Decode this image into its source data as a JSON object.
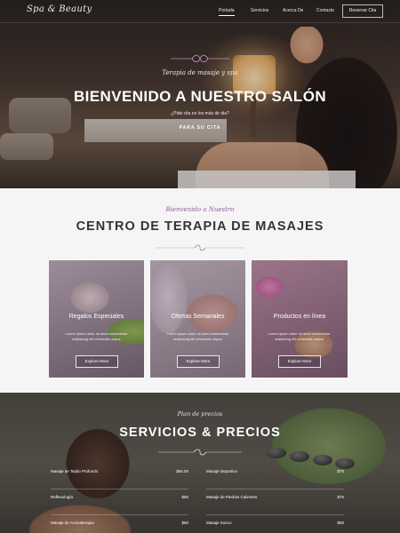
{
  "header": {
    "logo": "Spa & Beauty",
    "nav": [
      "Portada",
      "Servicios",
      "Acerca De",
      "Contacto"
    ],
    "nav_active_index": 0,
    "cta": "Reservar Cita"
  },
  "hero": {
    "script": "Terapia de masaje y spa",
    "title": "BIENVENIDO A NUESTRO SALÓN",
    "subtitle": "¿Pide cita en los más de dia?",
    "link": "PARA SU CITA"
  },
  "intro": {
    "script": "Bienvenido a Nuestro",
    "title": "CENTRO DE TERAPIA DE MASAJES"
  },
  "cards": [
    {
      "title": "Regalos Especiales",
      "text": "Lorem ipsum dolor sit amet consectetur adipiscing elit venenatis neque",
      "button": "Explore More"
    },
    {
      "title": "Ofertas Semanales",
      "text": "Lorem ipsum dolor sit amet consectetur adipiscing elit venenatis neque",
      "button": "Explore More"
    },
    {
      "title": "Productos en línea",
      "text": "Lorem ipsum dolor sit amet consectetur adipiscing elit venenatis neque",
      "button": "Explore More"
    }
  ],
  "prices": {
    "script": "Plan de precios",
    "title": "SERVICIOS & PRECIOS",
    "left": [
      {
        "name": "Masaje de Tejido Profundo",
        "price": "$65.00"
      },
      {
        "name": "Reflexología",
        "price": "$55"
      },
      {
        "name": "Masaje de Aromaterapia",
        "price": "$60"
      }
    ],
    "right": [
      {
        "name": "Masaje Deportivo",
        "price": "$70"
      },
      {
        "name": "Masaje de Piedras Calientes",
        "price": "$75"
      },
      {
        "name": "Masaje Sueco",
        "price": "$50"
      }
    ]
  },
  "colors": {
    "accent": "#8e5c9b",
    "script_accent": "#b58cc2"
  }
}
